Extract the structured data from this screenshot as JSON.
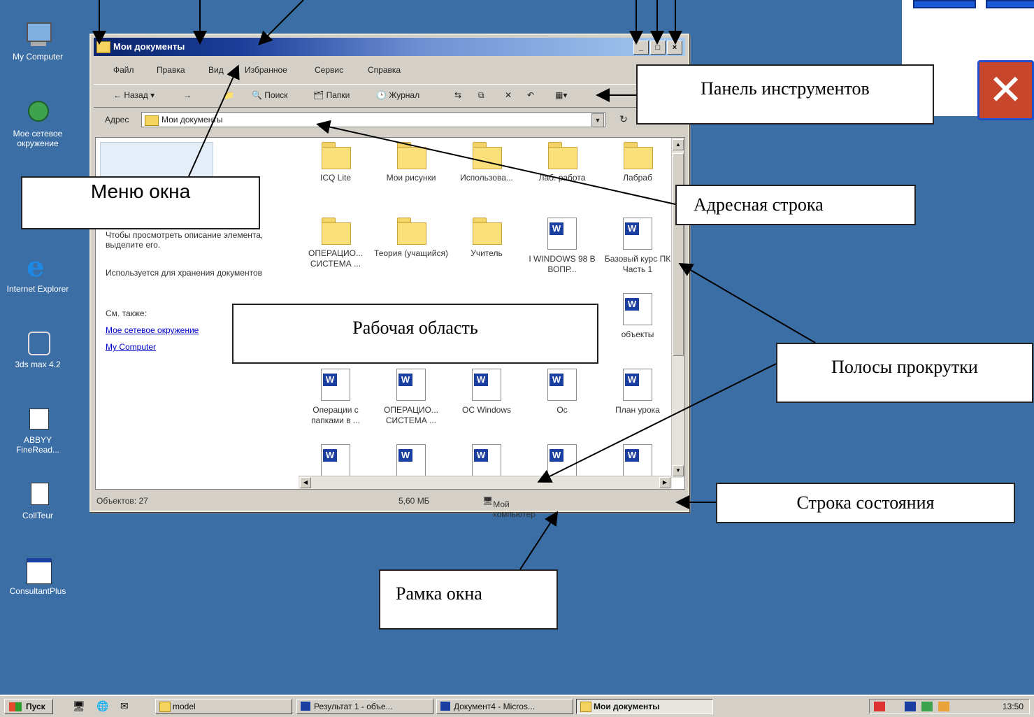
{
  "desktop": {
    "icons": [
      {
        "label": "My Computer"
      },
      {
        "label": "Мое сетевое окружение"
      },
      {
        "label": "Internet Explorer"
      },
      {
        "label": "3ds max 4.2"
      },
      {
        "label": "ABBYY FineRead..."
      },
      {
        "label": "CollTeur"
      },
      {
        "label": "ConsultantPlus"
      }
    ]
  },
  "window": {
    "title": "Мои документы",
    "buttons": {
      "minimize": "_",
      "maximize": "□",
      "close": "×"
    },
    "menu": [
      "Файл",
      "Правка",
      "Вид",
      "Избранное",
      "Сервис",
      "Справка"
    ],
    "toolbar": {
      "back": "Назад",
      "forward": "→",
      "search": "Поиск",
      "folders": "Папки",
      "journal": "Журнал"
    },
    "address": {
      "label": "Адрес",
      "value": "Мои документы"
    },
    "left_pane": {
      "hint": "Чтобы просмотреть описание элемента, выделите его.",
      "usage": "Используется для хранения документов",
      "see_also": "См. также:",
      "link1": "Мое сетевое окружение",
      "link2": "My Computer"
    },
    "items": [
      {
        "label": "ICQ Lite",
        "kind": "folder"
      },
      {
        "label": "Мои рисунки",
        "kind": "folder"
      },
      {
        "label": "Использова...",
        "kind": "folder"
      },
      {
        "label": "Лаб. работа",
        "kind": "folder"
      },
      {
        "label": "Лабраб",
        "kind": "folder"
      },
      {
        "label": "ОПЕРАЦИО... СИСТЕМА ...",
        "kind": "folder"
      },
      {
        "label": "Теория (учащийся)",
        "kind": "folder"
      },
      {
        "label": "Учитель",
        "kind": "folder"
      },
      {
        "label": "I WINDOWS 98 В ВОПР...",
        "kind": "doc"
      },
      {
        "label": "Базовый курс ПК Часть 1",
        "kind": "doc"
      },
      {
        "label": "объекты",
        "kind": "doc"
      },
      {
        "label": "Операции с папками в ...",
        "kind": "doc"
      },
      {
        "label": "ОПЕРАЦИО... СИСТЕМА ...",
        "kind": "ie"
      },
      {
        "label": "ОС Windows",
        "kind": "doc"
      },
      {
        "label": "Ос",
        "kind": "doc"
      },
      {
        "label": "План урока",
        "kind": "doc"
      }
    ],
    "status": {
      "objects": "Объектов: 27",
      "size": "5,60 МБ",
      "location": "Мой компьютер"
    }
  },
  "callouts": {
    "toolbar": "Панель инструментов",
    "menu": "Меню окна",
    "address": "Адресная  строка",
    "workspace": "Рабочая область",
    "scrollbars": "Полосы прокрутки",
    "statusbar": "Строка состояния",
    "frame": "Рамка окна"
  },
  "taskbar": {
    "start": "Пуск",
    "tasks": [
      "model",
      "Результат 1 - объе...",
      "Документ4 - Micros...",
      "Мои документы"
    ],
    "clock": "13:50"
  },
  "colors": {
    "desktop": "#3a6ea5",
    "titlebar": "#0a246a",
    "close": "#c8462c"
  }
}
